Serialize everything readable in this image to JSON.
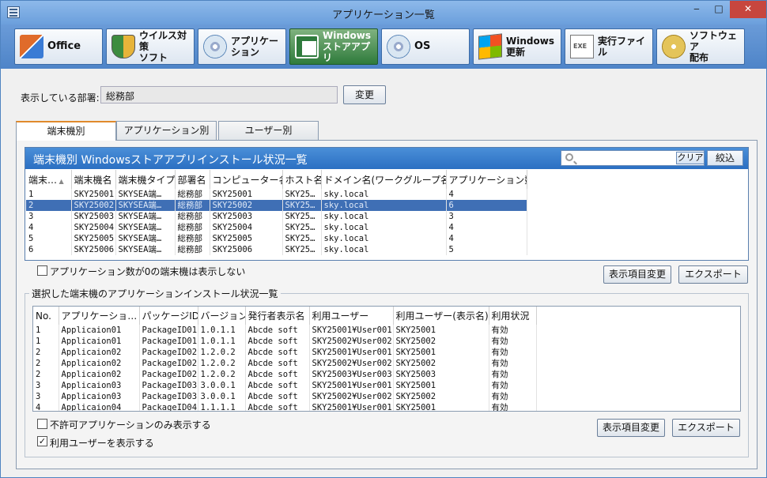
{
  "window": {
    "title": "アプリケーション一覧",
    "min": "‒",
    "max": "□",
    "close": "✕"
  },
  "toolbar": [
    {
      "label": "Office",
      "icon": "office-icon"
    },
    {
      "label": "ウイルス対策\nソフト",
      "icon": "shield-icon"
    },
    {
      "label": "アプリケーション",
      "icon": "disc-icon"
    },
    {
      "label": "Windows\nストアアプリ",
      "icon": "store-icon"
    },
    {
      "label": "OS",
      "icon": "disc-icon"
    },
    {
      "label": "Windows\n更新",
      "icon": "windows-flag-icon"
    },
    {
      "label": "実行ファイル",
      "icon": "exe-file-icon"
    },
    {
      "label": "ソフトウェア\n配布",
      "icon": "software-distribution-icon"
    }
  ],
  "dept": {
    "label": "表示している部署:",
    "value": "総務部",
    "change_button": "変更"
  },
  "tabs": [
    "端末機別",
    "アプリケーション別",
    "ユーザー別"
  ],
  "grid1": {
    "title": "端末機別 Windowsストアアプリインストール状況一覧",
    "search_placeholder": "",
    "clear_button": "クリア",
    "filter_button": "絞込",
    "columns": [
      "端末…",
      "端末機名",
      "端末機タイプ",
      "部署名",
      "コンピューター名",
      "ホスト名",
      "ドメイン名(ワークグループ名)",
      "アプリケーション数"
    ],
    "rows": [
      [
        "1",
        "SKY25001",
        "SKYSEA端…",
        "総務部",
        "SKY25001",
        "SKY25…",
        "sky.local",
        "4"
      ],
      [
        "2",
        "SKY25002",
        "SKYSEA端…",
        "総務部",
        "SKY25002",
        "SKY25…",
        "sky.local",
        "6"
      ],
      [
        "3",
        "SKY25003",
        "SKYSEA端…",
        "総務部",
        "SKY25003",
        "SKY25…",
        "sky.local",
        "3"
      ],
      [
        "4",
        "SKY25004",
        "SKYSEA端…",
        "総務部",
        "SKY25004",
        "SKY25…",
        "sky.local",
        "4"
      ],
      [
        "5",
        "SKY25005",
        "SKYSEA端…",
        "総務部",
        "SKY25005",
        "SKY25…",
        "sky.local",
        "4"
      ],
      [
        "6",
        "SKY25006",
        "SKYSEA端…",
        "総務部",
        "SKY25006",
        "SKY25…",
        "sky.local",
        "5"
      ]
    ],
    "selected_row": 1,
    "hide_zero_label": "アプリケーション数が0の端末機は表示しない",
    "display_items_button": "表示項目変更",
    "export_button": "エクスポート"
  },
  "grid2": {
    "group_title": "選択した端末機のアプリケーションインストール状況一覧",
    "columns": [
      "No.",
      "アプリケーショ…",
      "パッケージID",
      "バージョン",
      "発行者表示名",
      "利用ユーザー",
      "利用ユーザー(表示名)",
      "利用状況"
    ],
    "rows": [
      [
        "1",
        "Applicaion01",
        "PackageID01",
        "1.0.1.1",
        "Abcde soft",
        "SKY25001¥User001",
        "SKY25001",
        "有効"
      ],
      [
        "1",
        "Applicaion01",
        "PackageID01",
        "1.0.1.1",
        "Abcde soft",
        "SKY25002¥User002",
        "SKY25002",
        "有効"
      ],
      [
        "2",
        "Applicaion02",
        "PackageID02",
        "1.2.0.2",
        "Abcde soft",
        "SKY25001¥User001",
        "SKY25001",
        "有効"
      ],
      [
        "2",
        "Applicaion02",
        "PackageID02",
        "1.2.0.2",
        "Abcde soft",
        "SKY25002¥User002",
        "SKY25002",
        "有効"
      ],
      [
        "2",
        "Applicaion02",
        "PackageID02",
        "1.2.0.2",
        "Abcde soft",
        "SKY25003¥User003",
        "SKY25003",
        "有効"
      ],
      [
        "3",
        "Applicaion03",
        "PackageID03",
        "3.0.0.1",
        "Abcde soft",
        "SKY25001¥User001",
        "SKY25001",
        "有効"
      ],
      [
        "3",
        "Applicaion03",
        "PackageID03",
        "3.0.0.1",
        "Abcde soft",
        "SKY25002¥User002",
        "SKY25002",
        "有効"
      ],
      [
        "4",
        "Applicaion04",
        "PackageID04",
        "1.1.1.1",
        "Abcde soft",
        "SKY25001¥User001",
        "SKY25001",
        "有効"
      ]
    ],
    "disallowed_only_label": "不許可アプリケーションのみ表示する",
    "show_users_label": "利用ユーザーを表示する",
    "show_users_checked": "✓",
    "display_items_button": "表示項目変更",
    "export_button": "エクスポート"
  }
}
